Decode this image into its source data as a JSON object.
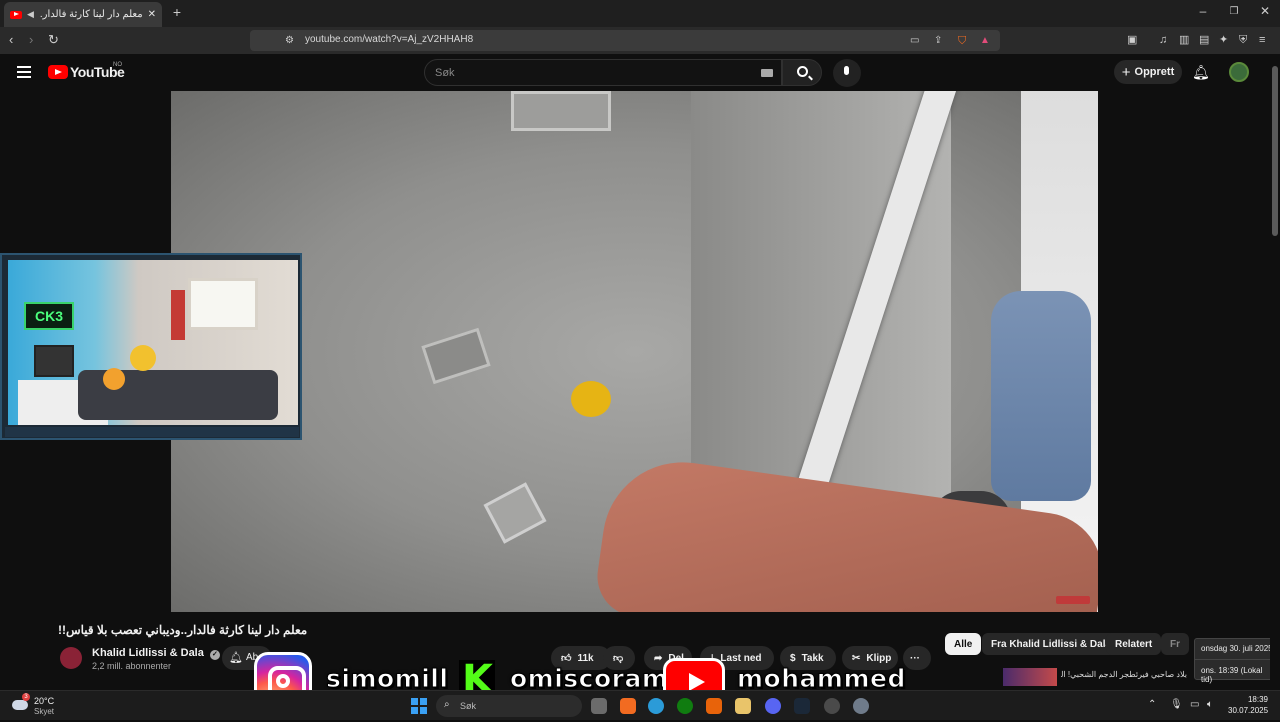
{
  "browser": {
    "tab_title": "معلم دار لينا كارثة فالدار..وديباني...",
    "url": "youtube.com/watch?v=Aj_zV2HHAH8",
    "close_glyph": "✕",
    "new_tab_glyph": "+"
  },
  "youtube": {
    "logo_text": "YouTube",
    "country": "NO",
    "search_placeholder": "Søk",
    "create_label": "Opprett"
  },
  "video": {
    "title": "معلم دار لينا كارثة فالدار..وديباني تعصب بلا قياس!!",
    "channel_name": "Khalid Lidlissi & Dala",
    "verified_glyph": "✓",
    "subscribers": "2,2 mill. abonnenter",
    "subscribe_label": "Ab",
    "webcam_sign": "CK3"
  },
  "actions": {
    "likes": "11k",
    "share": "Del",
    "download": "Last ned",
    "thanks": "Takk",
    "clip": "Klipp",
    "more": "···"
  },
  "chips": [
    "Alle",
    "Fra Khalid Lidlissi & Dala",
    "Relatert",
    "Fr"
  ],
  "recommendation": {
    "title": "بلاد صاحبي فيرئطجر الدجم الشحبي! الصلفة بوقة كلي عليه"
  },
  "tooltip": {
    "line1": "onsdag 30. juli 2025",
    "line2": "ons. 18:39 (Lokal tid)"
  },
  "social": {
    "instagram": "simomill",
    "kick": "omiscoram",
    "youtube": "mohammed sebrani"
  },
  "taskbar": {
    "temperature": "20°C",
    "weather": "Skyet",
    "search": "Søk",
    "time": "18:39",
    "date": "30.07.2025",
    "notifications": "3"
  },
  "colors": {
    "youtube_red": "#ff0000",
    "kick_green": "#53fc18",
    "background": "#0f0f0f"
  }
}
